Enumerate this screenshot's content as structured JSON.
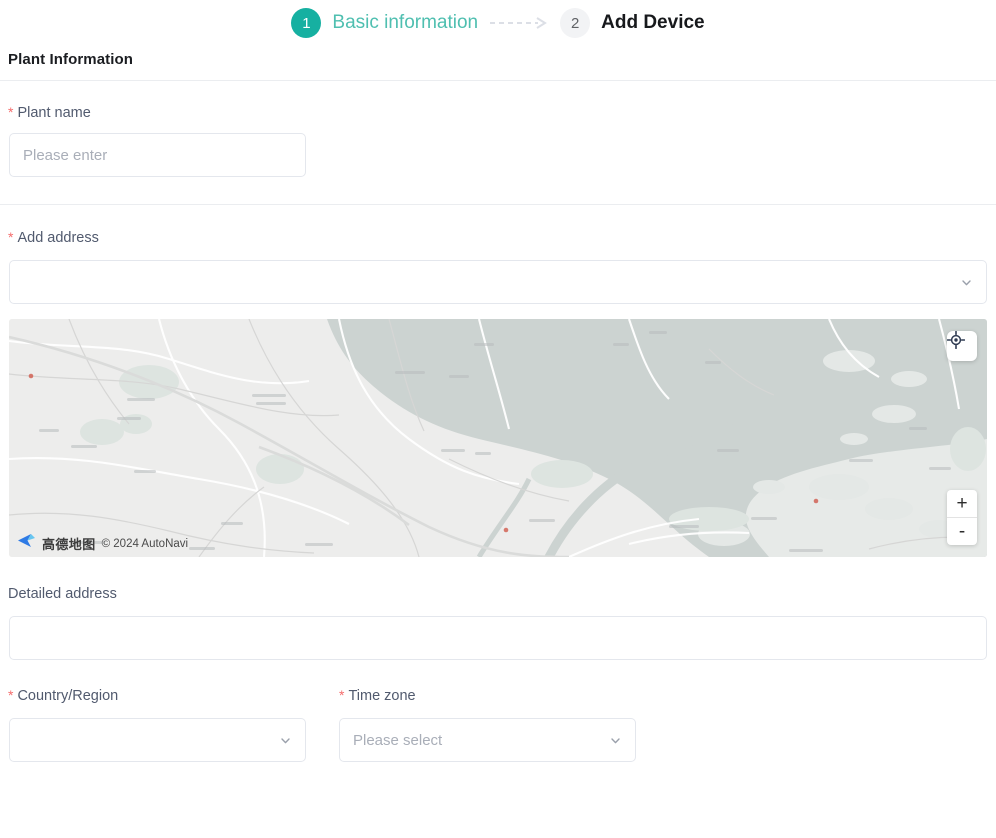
{
  "stepper": {
    "steps": [
      {
        "number": "1",
        "label": "Basic information",
        "state": "active"
      },
      {
        "number": "2",
        "label": "Add Device",
        "state": "inactive"
      }
    ],
    "connector_icon": "dashed-arrow-right-icon"
  },
  "section": {
    "title": "Plant Information"
  },
  "form": {
    "plant_name": {
      "label": "Plant name",
      "required_mark": "*",
      "value": "",
      "placeholder": "Please enter"
    },
    "add_address": {
      "label": "Add address",
      "required_mark": "*",
      "value": "",
      "placeholder": "",
      "icon": "chevron-down-icon"
    },
    "detailed_address": {
      "label": "Detailed address",
      "value": "",
      "placeholder": ""
    },
    "country_region": {
      "label": "Country/Region",
      "required_mark": "*",
      "value": "",
      "placeholder": "",
      "icon": "chevron-down-icon"
    },
    "time_zone": {
      "label": "Time zone",
      "required_mark": "*",
      "value": "",
      "placeholder": "Please select",
      "icon": "chevron-down-icon"
    }
  },
  "map": {
    "provider_cn": "高德地图",
    "attribution": "© 2024 AutoNavi",
    "logo_icon": "autonavi-arrow-logo-icon",
    "locate_icon": "crosshair-locate-icon",
    "zoom_in_label": "+",
    "zoom_out_label": "-"
  },
  "colors": {
    "accent": "#16b0a1",
    "accent_label": "#4fbfb0",
    "required": "#f56c6c",
    "label_text": "#515a6e",
    "border": "#e4e7ed",
    "placeholder": "#a9aeb8",
    "map_land": "#ededec",
    "map_water": "#ccd3d1"
  }
}
